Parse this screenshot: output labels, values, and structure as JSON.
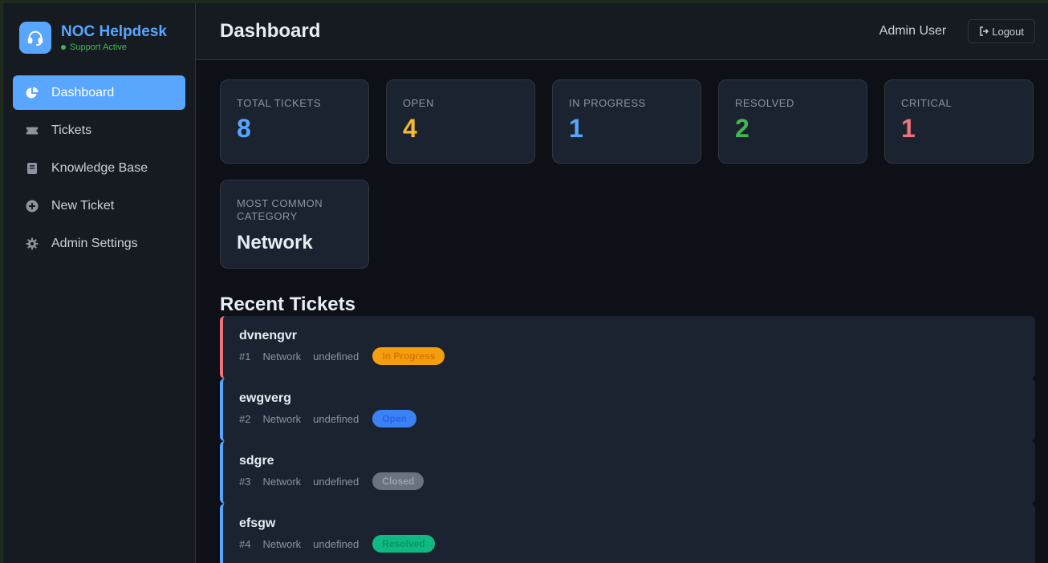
{
  "brand": {
    "title": "NOC Helpdesk",
    "status": "Support Active"
  },
  "sidebar": {
    "items": [
      {
        "label": "Dashboard",
        "icon": "pie-chart-icon",
        "active": true
      },
      {
        "label": "Tickets",
        "icon": "ticket-icon"
      },
      {
        "label": "Knowledge Base",
        "icon": "book-icon"
      },
      {
        "label": "New Ticket",
        "icon": "plus-circle-icon"
      },
      {
        "label": "Admin Settings",
        "icon": "gear-icon"
      }
    ]
  },
  "header": {
    "title": "Dashboard",
    "user": "Admin User",
    "logout_label": "Logout"
  },
  "stats": [
    {
      "label": "Total Tickets",
      "value": "8",
      "color": "#58a6ff"
    },
    {
      "label": "Open",
      "value": "4",
      "color": "#f5b82e"
    },
    {
      "label": "In Progress",
      "value": "1",
      "color": "#58a6ff"
    },
    {
      "label": "Resolved",
      "value": "2",
      "color": "#3fb950"
    },
    {
      "label": "Critical",
      "value": "1",
      "color": "#f0727a"
    }
  ],
  "common_category": {
    "label": "Most Common Category",
    "value": "Network"
  },
  "recent": {
    "title": "Recent Tickets",
    "tickets": [
      {
        "title": "dvnengvr",
        "id": "#1",
        "category": "Network",
        "extra": "undefined",
        "status": "In Progress"
      },
      {
        "title": "ewgverg",
        "id": "#2",
        "category": "Network",
        "extra": "undefined",
        "status": "Open"
      },
      {
        "title": "sdgre",
        "id": "#3",
        "category": "Network",
        "extra": "undefined",
        "status": "Closed"
      },
      {
        "title": "efsgw",
        "id": "#4",
        "category": "Network",
        "extra": "undefined",
        "status": "Resolved"
      }
    ]
  }
}
